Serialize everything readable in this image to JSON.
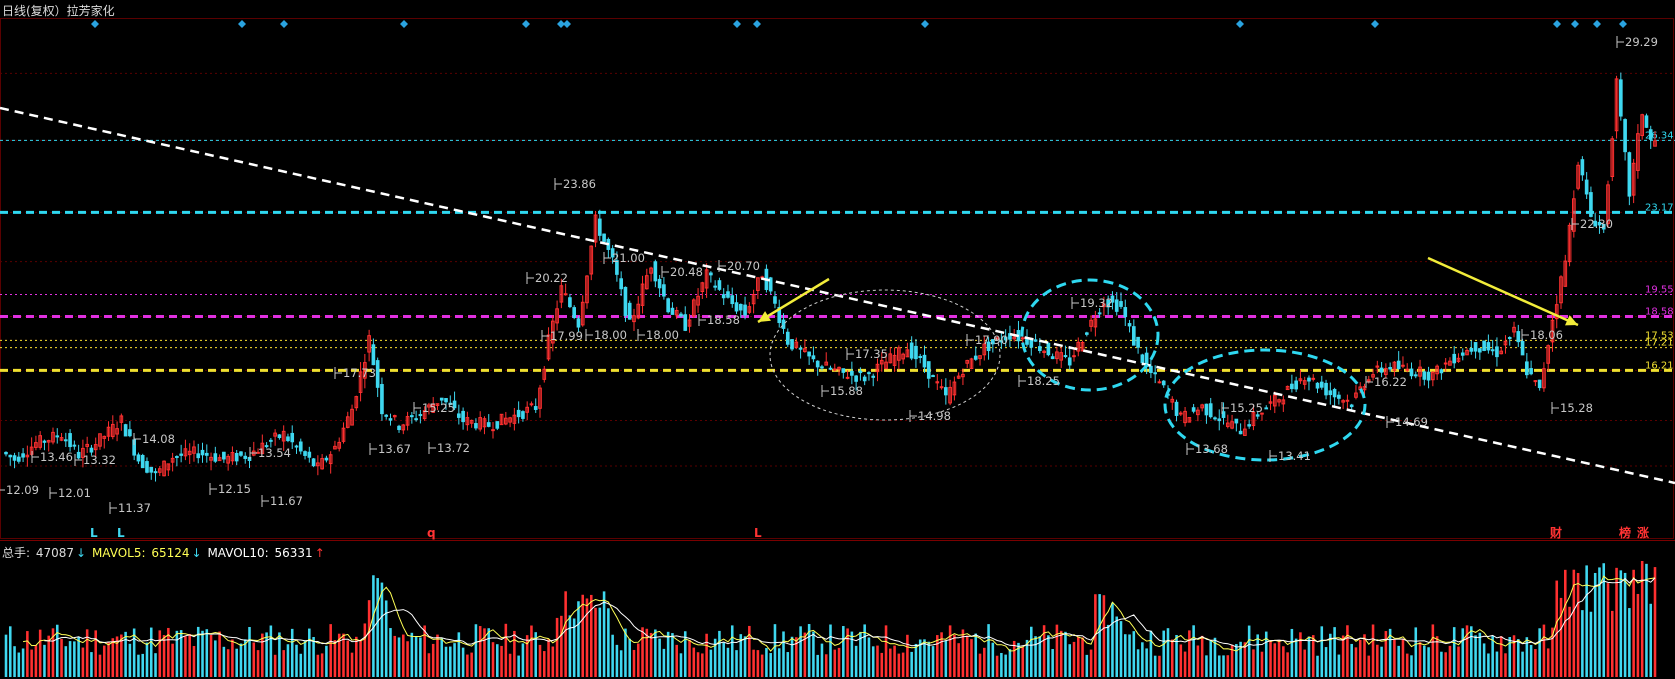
{
  "header": {
    "title": "日线(复权）拉芳家化"
  },
  "volume_legend": {
    "total_label": "总手: ",
    "total_value": "47087",
    "total_arrow": "↓",
    "ma5_label": "MAVOL5: ",
    "ma5_value": "65124",
    "ma5_arrow": "↓",
    "ma10_label": "MAVOL10: ",
    "ma10_value": "56331",
    "ma10_arrow": "↑"
  },
  "colors": {
    "up": "#ff3030",
    "down": "#3fd8f0",
    "grid": "#5a0000",
    "cyan_level": "#2fd8f0",
    "magenta_level": "#e030e0",
    "yellow_level": "#f0e030",
    "trendline": "#ffffff",
    "arrow": "#f2ec3a",
    "label": "#c8c8c8"
  },
  "chart_data": {
    "type": "candlestick",
    "ylim": [
      10.5,
      31.2
    ],
    "x_count": 280,
    "price_series": [
      [
        0,
        12.6
      ],
      [
        5,
        12.2
      ],
      [
        10,
        13.2
      ],
      [
        15,
        13.4
      ],
      [
        20,
        12.8
      ],
      [
        25,
        13.1
      ],
      [
        30,
        14.0
      ],
      [
        35,
        12.4
      ],
      [
        40,
        11.5
      ],
      [
        45,
        12.3
      ],
      [
        50,
        12.5
      ],
      [
        55,
        12.6
      ],
      [
        60,
        12.3
      ],
      [
        65,
        12.4
      ],
      [
        70,
        12.5
      ],
      [
        75,
        12.6
      ],
      [
        80,
        12.2
      ],
      [
        85,
        12.9
      ],
      [
        90,
        13.0
      ],
      [
        95,
        12.4
      ],
      [
        100,
        11.8
      ],
      [
        105,
        12.4
      ],
      [
        110,
        12.9
      ],
      [
        115,
        13.8
      ],
      [
        120,
        15.8
      ],
      [
        125,
        17.6
      ],
      [
        130,
        15.0
      ],
      [
        135,
        14.0
      ],
      [
        140,
        13.8
      ],
      [
        145,
        14.2
      ],
      [
        150,
        13.8
      ],
      [
        155,
        14.4
      ],
      [
        160,
        15.0
      ],
      [
        165,
        14.6
      ],
      [
        170,
        14.0
      ],
      [
        175,
        14.2
      ],
      [
        180,
        14.0
      ],
      [
        185,
        13.8
      ],
      [
        190,
        13.9
      ],
      [
        195,
        14.6
      ],
      [
        200,
        16.0
      ],
      [
        205,
        18.8
      ],
      [
        210,
        20.2
      ],
      [
        215,
        18.4
      ],
      [
        220,
        22.6
      ],
      [
        225,
        22.0
      ],
      [
        230,
        18.3
      ],
      [
        235,
        18.4
      ],
      [
        240,
        19.8
      ],
      [
        245,
        20.8
      ],
      [
        250,
        19.6
      ],
      [
        255,
        18.3
      ],
      [
        260,
        19.5
      ],
      [
        265,
        20.3
      ],
      [
        270,
        19.8
      ],
      [
        275,
        18.7
      ],
      [
        280,
        19.4
      ],
      [
        285,
        19.1
      ],
      [
        290,
        20.3
      ],
      [
        295,
        18.4
      ]
    ],
    "candles": [],
    "price_labels": [
      "12.09",
      "13.46",
      "12.01",
      "13.32",
      "11.37",
      "14.08",
      "12.15",
      "13.54",
      "11.67",
      "17.73",
      "13.67",
      "15.25",
      "13.72",
      "20.22",
      "23.86",
      "17.99",
      "18.00",
      "21.00",
      "18.00",
      "20.48",
      "18.58",
      "20.70",
      "15.88",
      "17.35",
      "14.98",
      "17.90",
      "18.25",
      "19.32",
      "13.68",
      "15.25",
      "13.41",
      "16.22",
      "14.69",
      "18.06",
      "15.28",
      "22.30",
      "29.29"
    ],
    "level_labels": [
      "26.34",
      "23.17",
      "19.55",
      "18.58",
      "17.53",
      "17.21",
      "16.21"
    ],
    "events": [
      "L",
      "L",
      "q",
      "L",
      "财",
      "榜",
      "涨"
    ],
    "volume": {
      "series": [
        "总手",
        "MAVOL5",
        "MAVOL10"
      ],
      "values": [
        47087,
        65124,
        56331
      ]
    }
  }
}
